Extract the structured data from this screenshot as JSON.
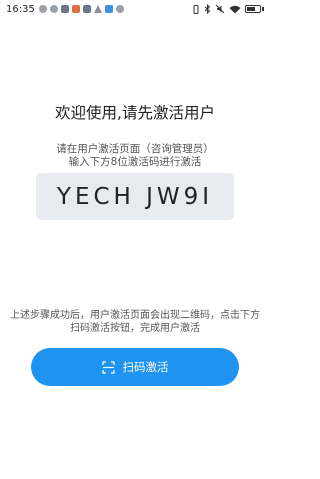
{
  "status_bar": {
    "time": "16:35",
    "icons_left": [
      "app-icon-1",
      "app-icon-2",
      "app-icon-3",
      "app-icon-4",
      "app-icon-5",
      "send-icon",
      "app-icon-6",
      "app-icon-7"
    ],
    "icons_right": [
      "vibrate-icon",
      "bluetooth-icon",
      "mute-icon",
      "wifi-icon",
      "battery-icon"
    ],
    "battery_level": 0.7
  },
  "activation": {
    "title": "欢迎使用,请先激活用户",
    "instruction_line1": "请在用户激活页面（咨询管理员）",
    "instruction_line2": "输入下方8位激活码进行激活",
    "code": "YECH JW9I",
    "hint": "上述步骤成功后，用户激活页面会出现二维码，点击下方扫码激活按钮，完成用户激活"
  },
  "scan_button": {
    "label": "扫码激活",
    "icon": "scan-icon",
    "color": "#1f93f0"
  }
}
